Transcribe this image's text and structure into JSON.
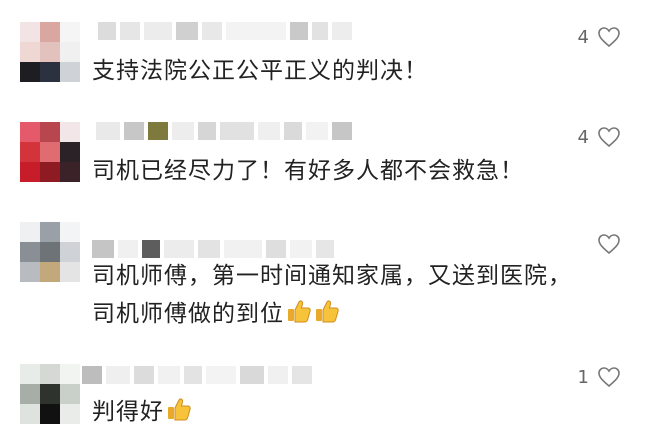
{
  "comments": [
    {
      "text": "支持法院公正公平正义的判决！",
      "likes": "4",
      "emoji": []
    },
    {
      "text": "司机已经尽力了！有好多人都不会救急！",
      "likes": "4",
      "emoji": []
    },
    {
      "lines": [
        "司机师傅，第一时间通知家属，又送到医院，",
        "司机师傅做的到位"
      ],
      "likes": "",
      "emoji": [
        "thumbs-up-icon",
        "thumbs-up-icon"
      ]
    },
    {
      "text": "判得好",
      "likes": "1",
      "emoji": [
        "thumbs-up-icon"
      ]
    }
  ]
}
